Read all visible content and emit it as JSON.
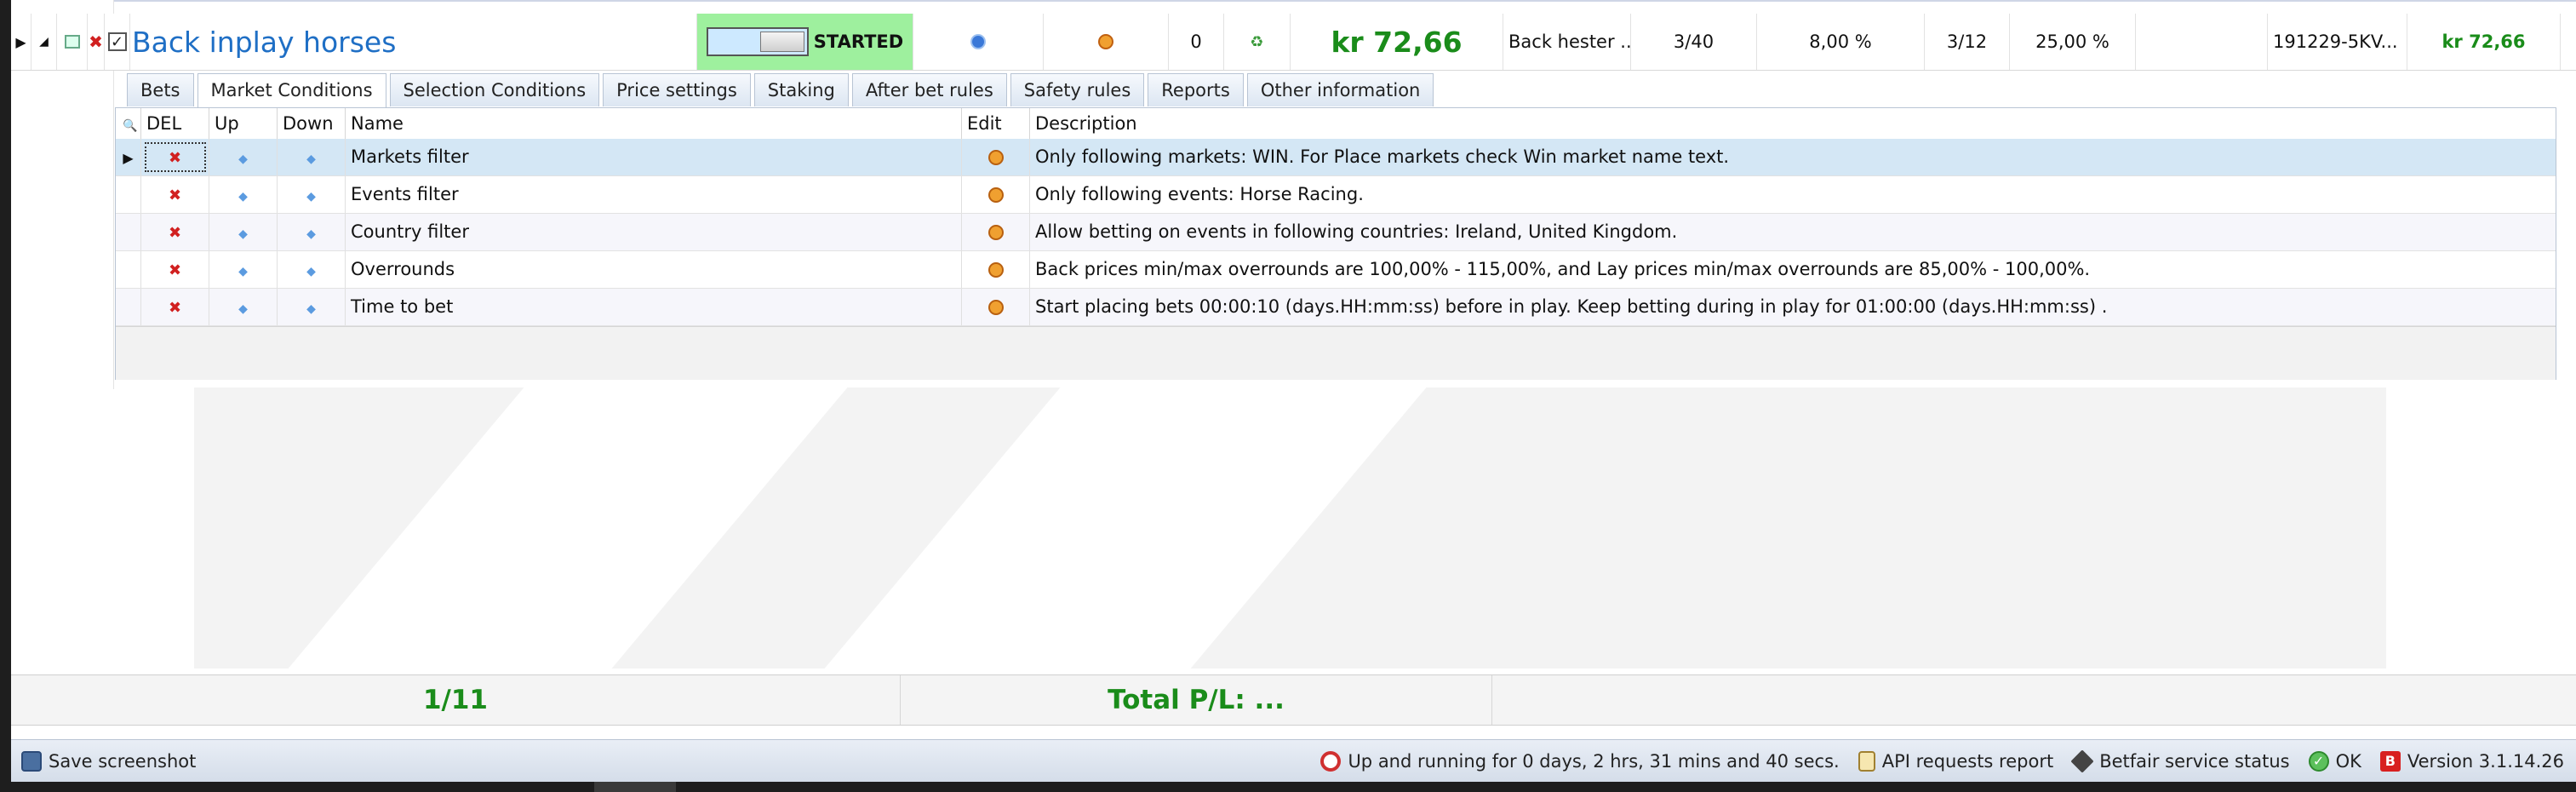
{
  "strategy": {
    "name": "Back inplay horses",
    "status": "STARTED",
    "bets_count": "0",
    "pl_large": "kr 72,66",
    "selection_text": "Back hester ...",
    "ratio_a": "3/40",
    "pct_a": "8,00 %",
    "ratio_b": "3/12",
    "pct_b": "25,00 %",
    "ref": "191229-5KV...",
    "pl_small": "kr 72,66"
  },
  "tabs": [
    {
      "label": "Bets"
    },
    {
      "label": "Market Conditions",
      "active": true
    },
    {
      "label": "Selection Conditions"
    },
    {
      "label": "Price settings"
    },
    {
      "label": "Staking"
    },
    {
      "label": "After bet rules"
    },
    {
      "label": "Safety rules"
    },
    {
      "label": "Reports"
    },
    {
      "label": "Other information"
    }
  ],
  "grid": {
    "headers": {
      "del": "DEL",
      "up": "Up",
      "down": "Down",
      "name": "Name",
      "edit": "Edit",
      "description": "Description"
    },
    "rows": [
      {
        "name": "Markets filter",
        "description": "Only following markets: WIN. For Place markets check Win market name text."
      },
      {
        "name": "Events filter",
        "description": "Only following events: Horse Racing."
      },
      {
        "name": "Country filter",
        "description": "Allow betting on events in following countries: Ireland, United Kingdom."
      },
      {
        "name": "Overrounds",
        "description": "Back prices min/max overrounds are 100,00% - 115,00%, and Lay prices min/max overrounds are 85,00% - 100,00%."
      },
      {
        "name": "Time to bet",
        "description": "Start placing bets 00:00:10 (days.HH:mm:ss) before in play. Keep betting during in play for 01:00:00 (days.HH:mm:ss) ."
      }
    ]
  },
  "summary": {
    "page": "1/11",
    "total_pl": "Total P/L: ..."
  },
  "statusbar": {
    "save_screenshot": "Save screenshot",
    "uptime": "Up and running for 0 days, 2 hrs, 31 mins and 40 secs.",
    "api_report": "API requests report",
    "service_status": "Betfair service status",
    "ok": "OK",
    "version": "Version 3.1.14.26"
  },
  "icons": {
    "expand": "expand-triangle-icon",
    "delete": "delete-x-icon",
    "move_up": "move-up-arrow-icon",
    "move_down": "move-down-arrow-icon",
    "edit": "edit-icon",
    "search": "search-icon"
  },
  "colors": {
    "accent_blue": "#1f6fc5",
    "profit_green": "#1a8c1a",
    "started_bg": "#9ef09e",
    "selected_row": "#d4e7f5",
    "delete_red": "#d12020"
  }
}
